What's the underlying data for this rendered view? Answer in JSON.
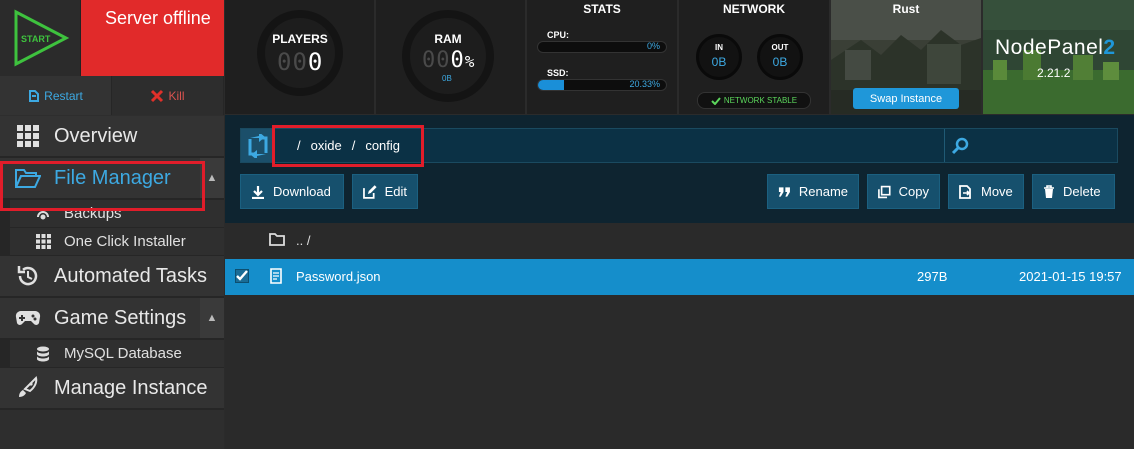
{
  "server": {
    "start_label": "START",
    "status": "Server offline",
    "restart_label": "Restart",
    "kill_label": "Kill",
    "colors": {
      "status_bg": "#e12a2a",
      "accent": "#1f97d9"
    }
  },
  "nav": {
    "overview": "Overview",
    "file_manager": "File Manager",
    "backups": "Backups",
    "one_click_installer": "One Click Installer",
    "automated_tasks": "Automated Tasks",
    "game_settings": "Game Settings",
    "mysql_database": "MySQL Database",
    "manage_instance": "Manage Instance"
  },
  "widgets": {
    "players": {
      "title": "PLAYERS",
      "ghost": "00",
      "value": "0"
    },
    "ram": {
      "title": "RAM",
      "ghost": "00",
      "value": "0",
      "unit": "%",
      "sub": "0B"
    },
    "stats": {
      "title": "STATS",
      "cpu_label": "CPU:",
      "cpu_value": "0%",
      "cpu_fraction": 0,
      "ssd_label": "SSD:",
      "ssd_value": "20.33%",
      "ssd_fraction": 0.2033
    },
    "network": {
      "title": "NETWORK",
      "in_label": "IN",
      "in_value": "0B",
      "out_label": "OUT",
      "out_value": "0B",
      "status": "NETWORK STABLE"
    },
    "game": {
      "title": "Rust",
      "swap_label": "Swap Instance"
    },
    "brand": {
      "name": "NodePanel",
      "number": "2",
      "version": "2.21.2"
    }
  },
  "file_manager": {
    "path": [
      "/",
      "oxide",
      "/",
      "config"
    ],
    "buttons": {
      "download": "Download",
      "edit": "Edit",
      "rename": "Rename",
      "copy": "Copy",
      "move": "Move",
      "delete": "Delete"
    },
    "parent_dir": ".. /",
    "files": [
      {
        "name": "Password.json",
        "size": "297B",
        "modified": "2021-01-15 19:57",
        "selected": true
      }
    ]
  }
}
